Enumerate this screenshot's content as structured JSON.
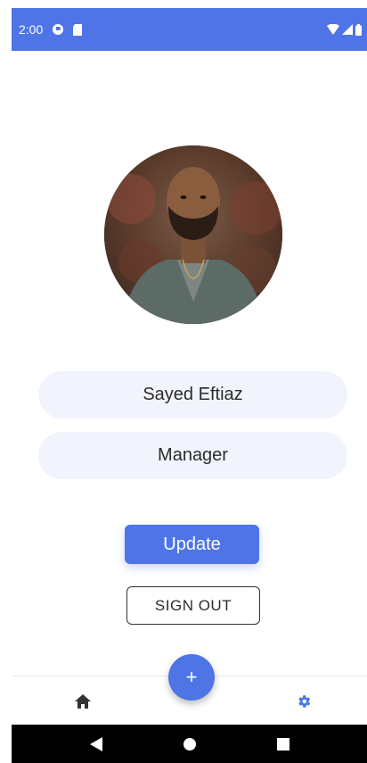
{
  "status_bar": {
    "time": "2:00",
    "icons": [
      "alarm-icon",
      "sd-card-icon",
      "wifi-icon",
      "signal-icon",
      "battery-icon"
    ]
  },
  "profile": {
    "name": "Sayed Eftiaz",
    "role": "Manager"
  },
  "actions": {
    "update_label": "Update",
    "signout_label": "SIGN OUT"
  },
  "bottom_nav": {
    "home_icon": "home-icon",
    "fab_label": "+",
    "settings_icon": "gear-icon"
  },
  "colors": {
    "accent": "#4e74e6",
    "field_bg": "#f2f4fd"
  }
}
